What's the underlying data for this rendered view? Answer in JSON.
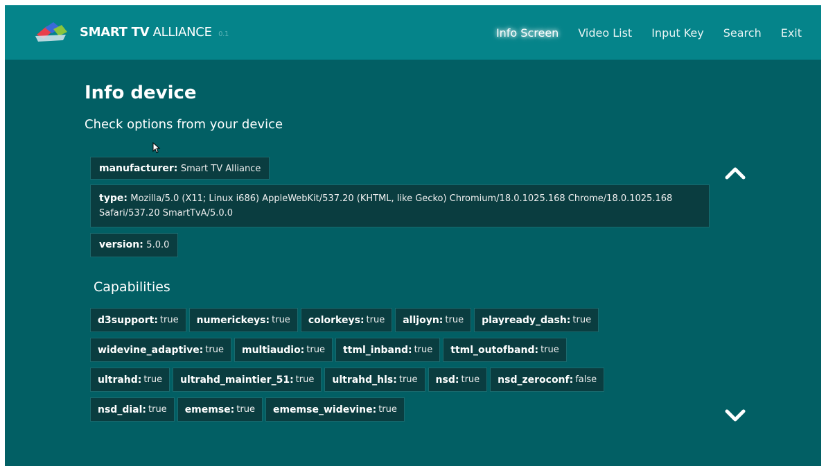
{
  "header": {
    "brand_bold": "SMART TV",
    "brand_light": "ALLIANCE",
    "brand_version": "0.1",
    "nav": [
      {
        "label": "Info Screen",
        "active": true
      },
      {
        "label": "Video List",
        "active": false
      },
      {
        "label": "Input Key",
        "active": false
      },
      {
        "label": "Search",
        "active": false
      },
      {
        "label": "Exit",
        "active": false
      }
    ]
  },
  "main": {
    "title": "Info device",
    "subtitle": "Check options from your device",
    "device_info": [
      {
        "key": "manufacturer:",
        "value": "Smart TV Alliance"
      },
      {
        "key": "type:",
        "value": "Mozilla/5.0 (X11; Linux i686) AppleWebKit/537.20 (KHTML, like Gecko) Chromium/18.0.1025.168 Chrome/18.0.1025.168 Safari/537.20 SmartTvA/5.0.0"
      },
      {
        "key": "version:",
        "value": "5.0.0"
      }
    ],
    "capabilities_title": "Capabilities",
    "capabilities": [
      [
        {
          "key": "d3support:",
          "value": "true"
        },
        {
          "key": "numerickeys:",
          "value": "true"
        },
        {
          "key": "colorkeys:",
          "value": "true"
        },
        {
          "key": "alljoyn:",
          "value": "true"
        },
        {
          "key": "playready_dash:",
          "value": "true"
        }
      ],
      [
        {
          "key": "widevine_adaptive:",
          "value": "true"
        },
        {
          "key": "multiaudio:",
          "value": "true"
        },
        {
          "key": "ttml_inband:",
          "value": "true"
        },
        {
          "key": "ttml_outofband:",
          "value": "true"
        }
      ],
      [
        {
          "key": "ultrahd:",
          "value": "true"
        },
        {
          "key": "ultrahd_maintier_51:",
          "value": "true"
        },
        {
          "key": "ultrahd_hls:",
          "value": "true"
        },
        {
          "key": "nsd:",
          "value": "true"
        },
        {
          "key": "nsd_zeroconf:",
          "value": "false"
        }
      ],
      [
        {
          "key": "nsd_dial:",
          "value": "true"
        },
        {
          "key": "ememse:",
          "value": "true"
        },
        {
          "key": "ememse_widevine:",
          "value": "true"
        }
      ]
    ]
  },
  "icons": {
    "logo": "smart-tv-alliance-logo",
    "scroll_up": "chevron-up-icon",
    "scroll_down": "chevron-down-icon",
    "cursor": "mouse-pointer-icon"
  },
  "colors": {
    "background": "#025f64",
    "header": "#05848a",
    "box": "#0a3d40"
  }
}
